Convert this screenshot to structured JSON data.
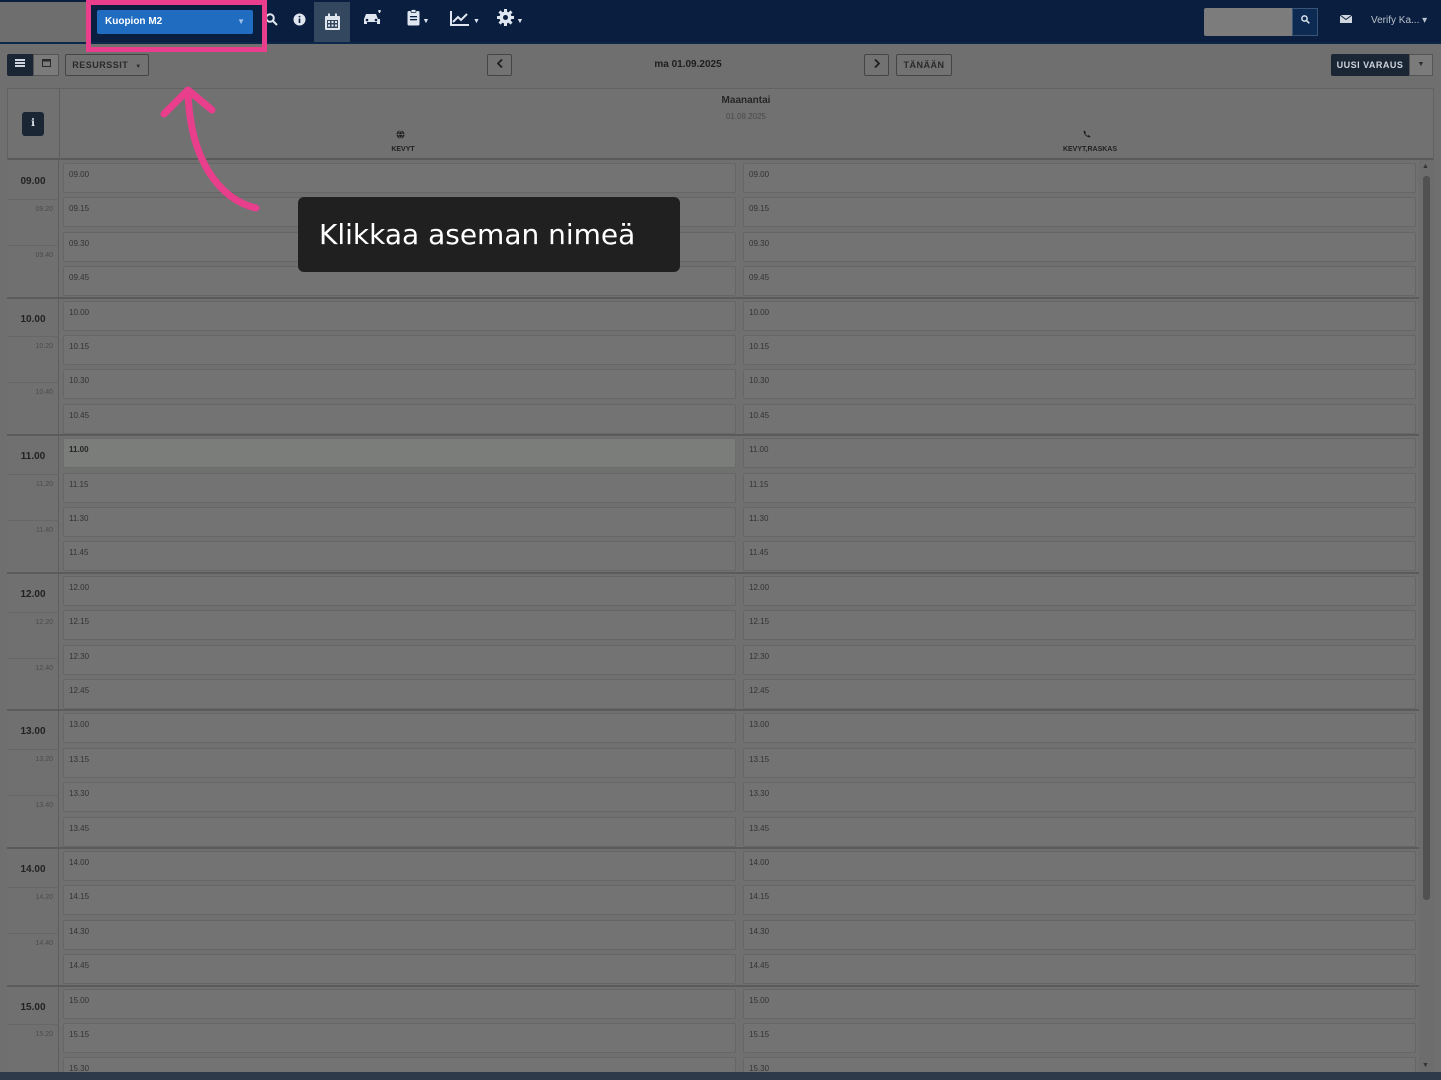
{
  "nav": {
    "station": "Kuopion M2",
    "icons": [
      "search-icon",
      "info-icon",
      "calendar-icon",
      "car-icon",
      "clipboard-icon",
      "chart-icon",
      "gear-icon"
    ],
    "user": "Verify Ka... ▾"
  },
  "toolbar": {
    "resources": "RESURSSIT",
    "date": "ma 01.09.2025",
    "today": "TÄNÄÄN",
    "new_booking": "UUSI VARAUS"
  },
  "header": {
    "day_name": "Maanantai",
    "day_date": "01.09.2025",
    "info": "i",
    "resources": [
      {
        "icon": "globe-icon",
        "label": "KEVYT"
      },
      {
        "icon": "phone-icon",
        "label": "KEVYT,RASKAS"
      }
    ]
  },
  "hours": [
    {
      "label": "09.00",
      "minors": [
        "09.20",
        "09.40"
      ]
    },
    {
      "label": "10.00",
      "minors": [
        "10.20",
        "10.40"
      ]
    },
    {
      "label": "11.00",
      "minors": [
        "11.20",
        "11.40"
      ]
    },
    {
      "label": "12.00",
      "minors": [
        "12.20",
        "12.40"
      ]
    },
    {
      "label": "13.00",
      "minors": [
        "13.20",
        "13.40"
      ]
    },
    {
      "label": "14.00",
      "minors": [
        "14.20",
        "14.40"
      ]
    },
    {
      "label": "15.00",
      "minors": [
        "15.20"
      ]
    }
  ],
  "slots": [
    "09.00",
    "09.15",
    "09.30",
    "09.45",
    "10.00",
    "10.15",
    "10.30",
    "10.45",
    "11.00",
    "11.15",
    "11.30",
    "11.45",
    "12.00",
    "12.15",
    "12.30",
    "12.45",
    "13.00",
    "13.15",
    "13.30",
    "13.45",
    "14.00",
    "14.15",
    "14.30",
    "14.45",
    "15.00",
    "15.15",
    "15.30"
  ],
  "highlighted_slot": {
    "column": 0,
    "time": "11.00"
  },
  "annotation": {
    "text": "Klikkaa aseman nimeä",
    "highlight_color": "#e83e8c"
  }
}
